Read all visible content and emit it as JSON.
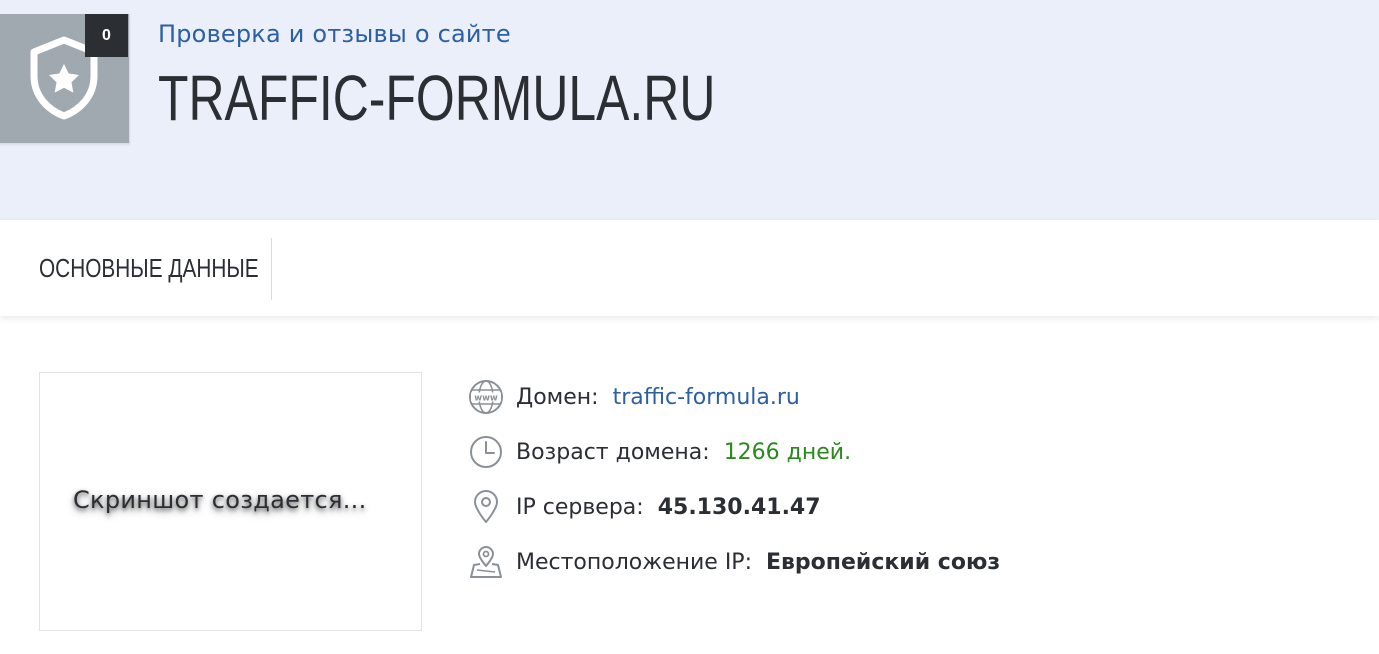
{
  "header": {
    "badge_count": "0",
    "subtitle": "Проверка и отзывы о сайте",
    "site_title": "TRAFFIC-FORMULA.RU"
  },
  "tabs": [
    {
      "label": "ОСНОВНЫЕ ДАННЫЕ"
    }
  ],
  "screenshot": {
    "placeholder_text": "Скриншот создается..."
  },
  "info": {
    "domain": {
      "label": "Домен:",
      "value": "traffic-formula.ru",
      "icon": "www-globe-icon"
    },
    "age": {
      "label": "Возраст домена:",
      "value": "1266 дней.",
      "icon": "clock-icon"
    },
    "ip": {
      "label": "IP сервера:",
      "value": "45.130.41.47",
      "icon": "location-pin-icon"
    },
    "location": {
      "label": "Местоположение IP:",
      "value": "Европейский союз",
      "icon": "map-pin-icon"
    }
  },
  "colors": {
    "header_bg": "#ebeff9",
    "accent_blue": "#2c5fa3",
    "green": "#2a8a1e",
    "dark_text": "#2b2e33",
    "shield_bg": "#a0a8b0"
  }
}
